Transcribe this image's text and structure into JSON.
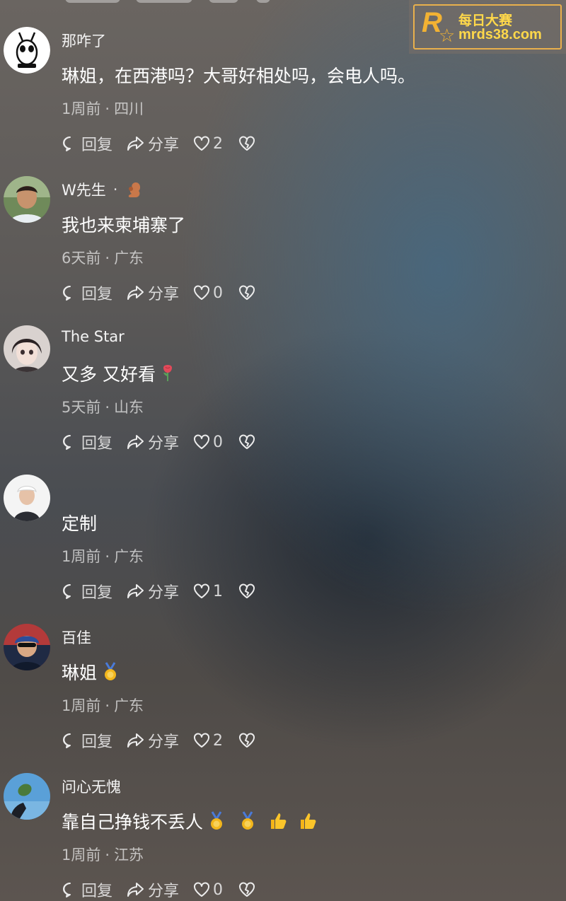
{
  "watermark": {
    "name": "每日大赛",
    "url": "mrds38.com",
    "logo_letter": "R"
  },
  "labels": {
    "reply": "回复",
    "share": "分享"
  },
  "comments": [
    {
      "user": "那咋了",
      "text": "琳姐，在西港吗？大哥好相处吗，会电人吗。",
      "time": "1周前",
      "location": "四川",
      "likes": "2",
      "avatar": "cartoon-ghost",
      "badge": ""
    },
    {
      "user": "W先生",
      "text": "我也来柬埔寨了",
      "time": "6天前",
      "location": "广东",
      "likes": "0",
      "avatar": "person-photo",
      "badge": "squirrel-icon"
    },
    {
      "user": "The Star",
      "text": "又多 又好看",
      "time": "5天前",
      "location": "山东",
      "likes": "0",
      "avatar": "anime-boy",
      "emoji": [
        "rose-icon"
      ]
    },
    {
      "user": "",
      "text": "定制",
      "time": "1周前",
      "location": "广东",
      "likes": "1",
      "avatar": "person-white"
    },
    {
      "user": "百佳",
      "text": "琳姐",
      "time": "1周前",
      "location": "广东",
      "likes": "2",
      "avatar": "cyclist-photo",
      "emoji": [
        "medal-icon"
      ]
    },
    {
      "user": "问心无愧",
      "text": "靠自己挣钱不丢人",
      "time": "1周前",
      "location": "江苏",
      "likes": "0",
      "avatar": "sky-leaf",
      "emoji": [
        "medal-icon",
        "medal-icon",
        "thumbs-up-icon",
        "thumbs-up-icon"
      ]
    }
  ]
}
